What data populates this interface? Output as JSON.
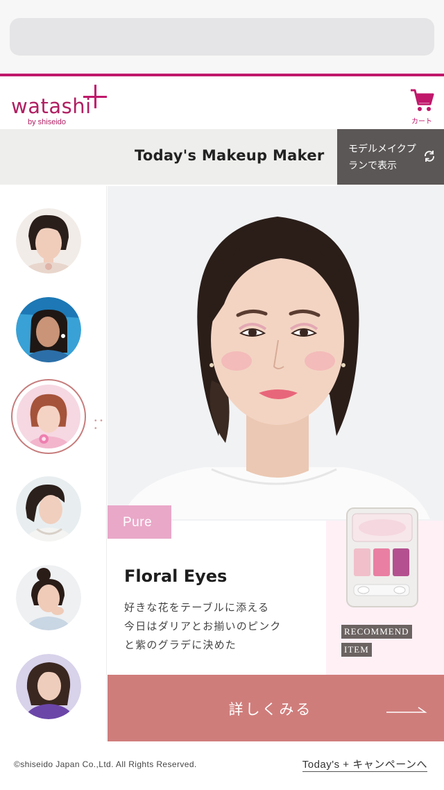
{
  "header": {
    "logo_word": "watashi",
    "logo_sub": "by shiseido",
    "cart_label": "カート"
  },
  "title_band": {
    "title": "Today's Makeup Maker",
    "model_plan_button": "モデルメイクプランで表示"
  },
  "sidebar": {
    "models": [
      {
        "selected": false,
        "outfit": "#e8d6cc",
        "background": "#f2ece8"
      },
      {
        "selected": false,
        "outfit": "#2c6fa8",
        "background": "#39a1d6"
      },
      {
        "selected": true,
        "outfit": "#f2b5cc",
        "background": "#f6d8e2"
      },
      {
        "selected": false,
        "outfit": "#f4f4f2",
        "background": "#e8eef0"
      },
      {
        "selected": false,
        "outfit": "#c9d6e3",
        "background": "#eef0f2"
      },
      {
        "selected": false,
        "outfit": "#6b46a8",
        "background": "#d8d2ea"
      }
    ]
  },
  "main": {
    "tag": "Pure",
    "card": {
      "title": "Floral Eyes",
      "description_line1": "好きな花をテーブルに添える",
      "description_line2": "今日はダリアとお揃いのピンク",
      "description_line3": "と紫のグラデに決めた"
    },
    "recommend": {
      "line1": "RECOMMEND",
      "line2": "ITEM",
      "palette_colors": [
        "#f0bfca",
        "#e97fa2",
        "#b4508f"
      ]
    },
    "detail_button": "詳しくみる"
  },
  "footer": {
    "copyright": "©shiseido Japan Co.,Ltd. All Rights Reserved.",
    "campaign_link": "Today's + キャンペーンへ"
  },
  "colors": {
    "brand": "#c0186b",
    "dark_button": "#5b5756",
    "cta": "#cf7d7b",
    "tag_pink": "#e9a8c8"
  },
  "icons": [
    "cart-icon",
    "refresh-icon",
    "arrow-right-icon"
  ]
}
